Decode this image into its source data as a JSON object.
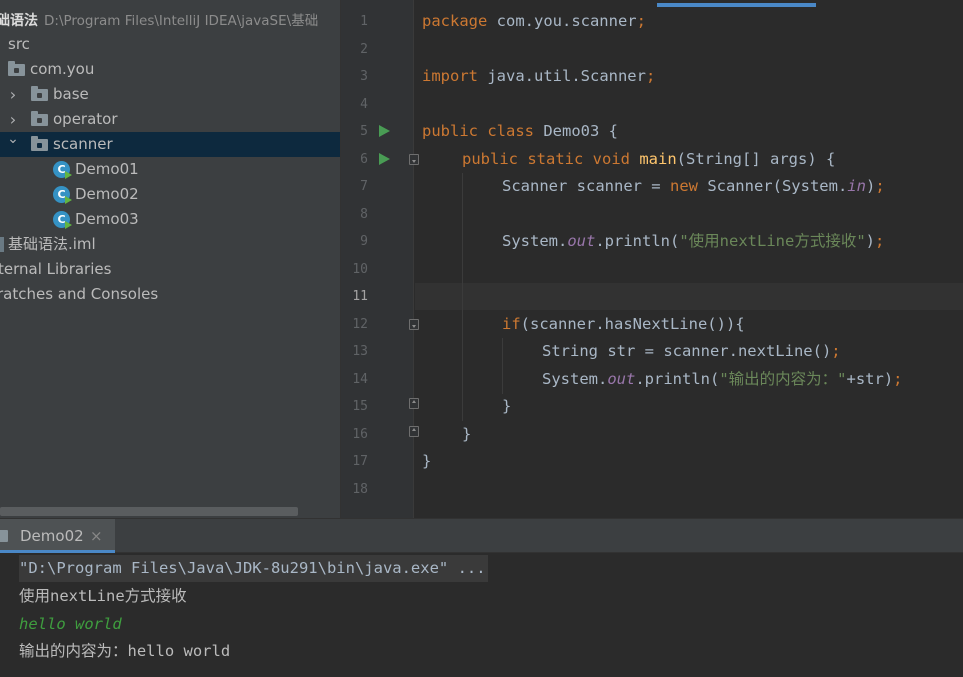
{
  "project": {
    "name": "础语法",
    "path": "D:\\Program Files\\IntelliJ IDEA\\javaSE\\基础"
  },
  "tree": {
    "items": [
      {
        "label": "src"
      },
      {
        "label": "com.you"
      },
      {
        "label": "base"
      },
      {
        "label": "operator"
      },
      {
        "label": "scanner"
      },
      {
        "label": "Demo01"
      },
      {
        "label": "Demo02"
      },
      {
        "label": "Demo03"
      },
      {
        "label": "基础语法.iml"
      },
      {
        "label": "ternal Libraries"
      },
      {
        "label": "ratches and Consoles"
      }
    ]
  },
  "editor": {
    "line_numbers": [
      "1",
      "2",
      "3",
      "4",
      "5",
      "6",
      "7",
      "8",
      "9",
      "10",
      "11",
      "12",
      "13",
      "14",
      "15",
      "16",
      "17",
      "18"
    ],
    "current_line": "11",
    "code": {
      "l1_pkg_kw": "package",
      "l1_pkg_name": " com.you.scanner",
      "l1_semi": ";",
      "l3_import_kw": "import",
      "l3_import_name": " java.util.Scanner",
      "l3_semi": ";",
      "l5_public": "public",
      "l5_class": " class",
      "l5_rest": " Demo03 {",
      "l6_public": "public",
      "l6_static": " static",
      "l6_void": " void",
      "l6_main": " main",
      "l6_rest": "(String[] args) {",
      "l7_a": "Scanner scanner = ",
      "l7_new": "new",
      "l7_b": " Scanner(System.",
      "l7_in": "in",
      "l7_c": ")",
      "l7_semi": ";",
      "l9_a": "System.",
      "l9_out": "out",
      "l9_b": ".println(",
      "l9_str": "\"使用nextLine方式接收\"",
      "l9_c": ")",
      "l9_semi": ";",
      "l12_if": "if",
      "l12_rest": "(scanner.hasNextLine()){",
      "l13_a": "String str = scanner.nextLine()",
      "l13_semi": ";",
      "l14_a": "System.",
      "l14_out": "out",
      "l14_b": ".println(",
      "l14_str": "\"输出的内容为：\"",
      "l14_c": "+str)",
      "l14_semi": ";",
      "l15": "}",
      "l16": "}",
      "l17": "}"
    }
  },
  "run": {
    "tab_label": "Demo02",
    "close_glyph": "×",
    "console": {
      "cmd": "\"D:\\Program Files\\Java\\JDK-8u291\\bin\\java.exe\" ...",
      "out1": "使用nextLine方式接收",
      "input": "hello world",
      "out2": "输出的内容为：hello world"
    }
  },
  "icons": {
    "tree_arrow_collapsed": "›",
    "tree_arrow_expanded": "⌄",
    "class_icon_letter": "C"
  },
  "colors": {
    "selection": "#0d293e",
    "keyword": "#cc7832",
    "method": "#ffc66d",
    "string": "#6a8759",
    "static_field": "#9876aa",
    "run_icon": "#499c54",
    "user_input": "#3f9e3f",
    "accent": "#4a88c7"
  }
}
